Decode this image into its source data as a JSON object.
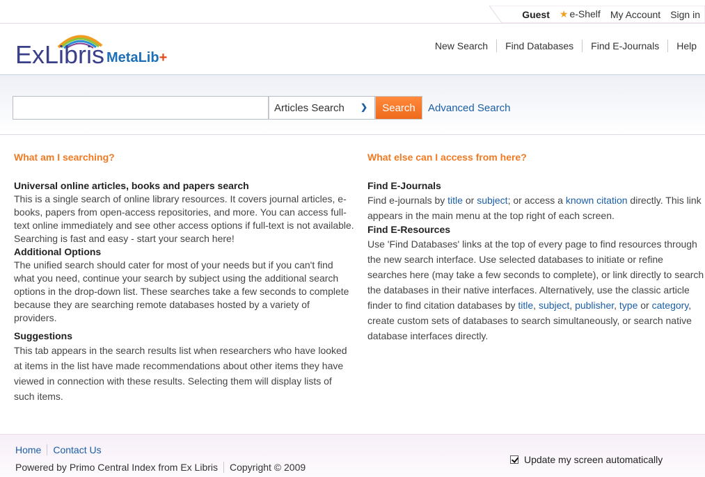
{
  "userbar": {
    "guest": "Guest",
    "eshelf": "e-Shelf",
    "account": "My Account",
    "signin": "Sign in"
  },
  "logo": {
    "exlibris": "ExLibris",
    "metalib": "MetaLib",
    "plus": "+"
  },
  "nav": [
    "New Search",
    "Find Databases",
    "Find E-Journals",
    "Help"
  ],
  "search": {
    "value": "",
    "scope": "Articles Search",
    "button": "Search",
    "advanced": "Advanced Search"
  },
  "left": {
    "heading": "What am I searching?",
    "s1_title": "Universal online articles, books and papers search",
    "s1_text": "This is a single search of online library resources. It covers journal articles, e-books, papers from open-access repositories, and more. You can access full-text online immediately and see other access options if full-text is not available. Searching is fast and easy - start your search here!",
    "s2_title": "Additional Options",
    "s2_text": "The unified search should cater for most of your needs but if you can't find what you need, continue your search by subject using the additional search options in the drop-down list. These searches take a few seconds to complete because they are searching remote databases hosted by a variety of providers.",
    "s3_title": "Suggestions",
    "s3_text": "This tab appears in the search results list when researchers who have looked at items in the list have made recommendations about other items they have viewed in connection with these results. Selecting them will display lists of  such items."
  },
  "right": {
    "heading": "What else can I access from here?",
    "s1_title": "Find E-Journals",
    "s1_a": "Find e-journals by ",
    "s1_link_title": "title",
    "s1_b": " or ",
    "s1_link_subject": "subject",
    "s1_c": "; or access a ",
    "s1_link_citation": "known citation",
    "s1_d": " directly. This link appears in the main menu at the top right of each screen.",
    "s2_title": "Find E-Resources",
    "s2_a": "Use 'Find Databases' links at the top of every page to find resources through the new search interface. Use selected databases to initiate or refine searches here (may take a few seconds to complete), or link directly to search the databases in their native interfaces. Alternatively, use the classic article finder to find citation databases by ",
    "s2_link_title": "title",
    "s2_sep1": ", ",
    "s2_link_subject": "subject",
    "s2_sep2": ", ",
    "s2_link_publisher": "publisher",
    "s2_sep3": ", ",
    "s2_link_type": "type",
    "s2_or": " or ",
    "s2_link_category": "category",
    "s2_b": ", create custom sets of databases to search simultaneously, or search native database interfaces directly."
  },
  "footer": {
    "home": "Home",
    "contact": "Contact Us",
    "powered": "Powered by Primo Central Index from Ex Libris",
    "copyright": "Copyright © 2009",
    "auto_update": "Update my screen automatically"
  }
}
